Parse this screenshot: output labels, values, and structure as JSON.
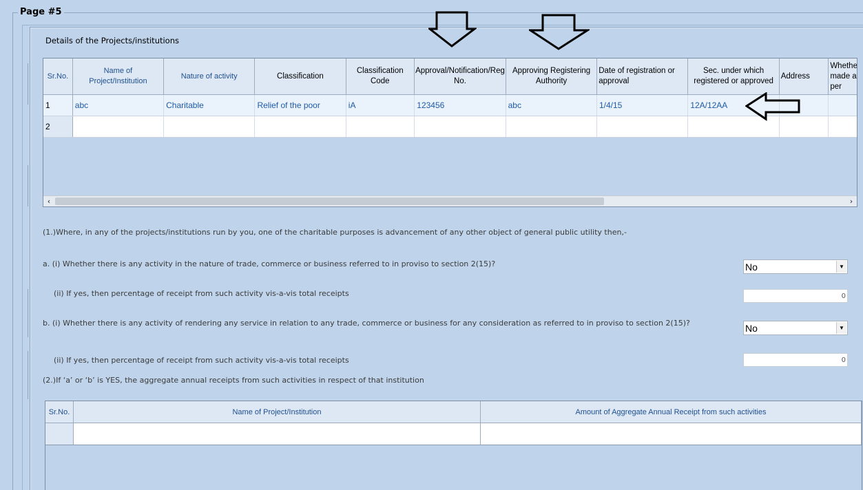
{
  "page": {
    "title": "Page #5"
  },
  "dialog": {
    "title": "Details of the Projects/institutions",
    "projects_grid": {
      "headers": [
        "Sr.No.",
        "Name of Project/Institution",
        "Nature of activity",
        "Classification",
        "Classification Code",
        "Approval/Notification/Reg No.",
        "Approving Registering Authority",
        "Date of registration or approval",
        "Sec. under which registered or approved",
        "Address",
        "Whether made as per"
      ],
      "rows": [
        [
          "1",
          "abc",
          "Charitable",
          "Relief of the poor",
          "iA",
          "123456",
          "abc",
          "1/4/15",
          "12A/12AA",
          "",
          ""
        ],
        [
          "2",
          "",
          "",
          "",
          "",
          "",
          "",
          "",
          "",
          "",
          ""
        ]
      ]
    },
    "q1_intro": "(1.)Where, in any of the projects/institutions run by you, one of the charitable purposes is advancement of any other object of general public utility then,-",
    "qa_i": {
      "text": "a. (i) Whether there is any activity in the nature of trade, commerce or business referred to in proviso to section 2(15)?",
      "value": "No"
    },
    "qa_ii": {
      "text": "(ii) If yes, then percentage of receipt from such activity vis-a-vis total receipts",
      "value": "0"
    },
    "qb_i": {
      "text": "b. (i) Whether there is any activity of rendering any service in relation to any trade, commerce or business for any consideration as referred to in proviso to section 2(15)?",
      "value": "No"
    },
    "qb_ii": {
      "text": "(ii) If yes, then percentage of receipt from such activity vis-a-vis total receipts",
      "value": "0"
    },
    "q2_intro": "(2.)If ‘a’ or ‘b’ is YES, the aggregate annual receipts from such activities in respect of that institution",
    "receipts_grid": {
      "headers": [
        "Sr.No.",
        "Name of Project/Institution",
        "Amount of Aggregate Annual Receipt from such activities"
      ]
    }
  },
  "icons": {
    "scroll_left": "‹",
    "scroll_right": "›",
    "dropdown": "▼"
  }
}
